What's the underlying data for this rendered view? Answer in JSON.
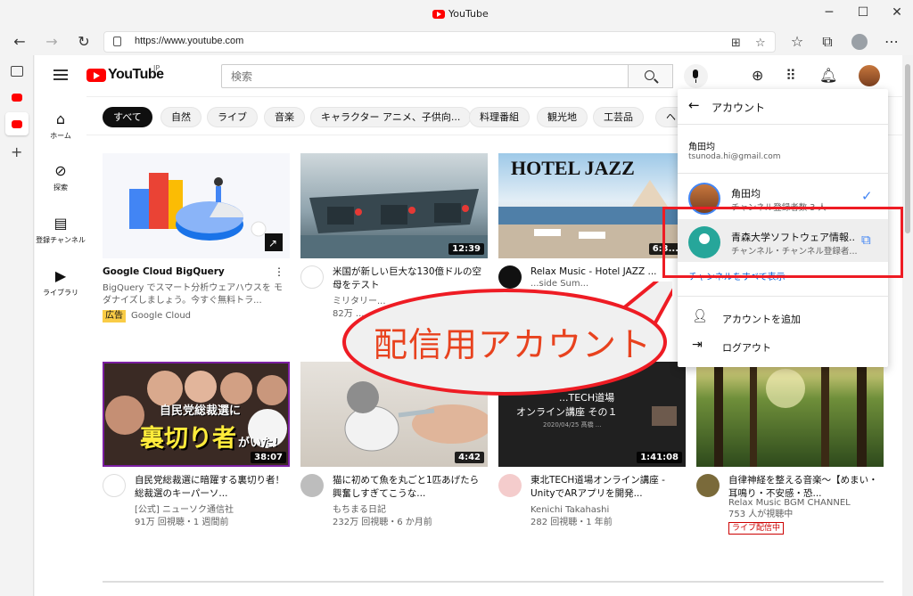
{
  "window": {
    "title": "YouTube"
  },
  "browser": {
    "url": "https://www.youtube.com"
  },
  "masthead": {
    "logo_text": "YouTube",
    "region": "JP",
    "search_placeholder": "検索"
  },
  "guide": [
    {
      "label": "ホーム",
      "icon": "home-icon"
    },
    {
      "label": "探索",
      "icon": "compass-icon"
    },
    {
      "label": "登録チャンネル",
      "icon": "subscriptions-icon"
    },
    {
      "label": "ライブラリ",
      "icon": "library-icon"
    }
  ],
  "chips": [
    "すべて",
    "自然",
    "ライブ",
    "音楽",
    "キャラクター アニメ、子供向...",
    "料理番組",
    "観光地",
    "工芸品"
  ],
  "videos": [
    {
      "title": "Google Cloud BigQuery",
      "desc": "BigQuery でスマート分析ウェアハウスを モダナイズしましょう。今すぐ無料トラ...",
      "ad": "広告",
      "channel": "Google Cloud"
    },
    {
      "title": "米国が新しい巨大な130億ドルの空母をテスト",
      "channel": "ミリタリー...",
      "stats": "82万 ...",
      "duration": "12:39"
    },
    {
      "title": "Relax Music - Hotel JAZZ ...",
      "line2": "...side Sum...",
      "thumb_text": "HOTEL JAZZ",
      "duration": "6:3..."
    },
    {
      "title": "自民党総裁選に暗躍する裏切り者！総裁選のキーパーソ...",
      "channel": "[公式] ニューソク通信社",
      "stats": "91万 回視聴・1 週間前",
      "duration": "38:07",
      "thumb_top": "自民党総裁選に",
      "thumb_main": "裏切り者",
      "thumb_tail": "がいた!"
    },
    {
      "title": "猫に初めて魚を丸ごと1匹あげたら興奮しすぎてこうな...",
      "channel": "もちまる日記",
      "stats": "232万 回視聴・6 か月前",
      "duration": "4:42"
    },
    {
      "title": "東北TECH道場オンライン講座 - UnityでARアプリを開発...",
      "channel": "Kenichi Takahashi",
      "stats": "282 回視聴・1 年前",
      "duration": "1:41:08",
      "thumb_line1": "...TECH道場",
      "thumb_line2": "オンライン講座 その１",
      "thumb_line3": "2020/04/25 髙橋 ..."
    },
    {
      "title": "自律神経を整える音楽～【めまい・耳鳴り・不安感・恐...",
      "channel": "Relax Music BGM CHANNEL",
      "stats": "753 人が視聴中",
      "live": "ライブ配信中"
    }
  ],
  "account_menu": {
    "header": "アカウント",
    "current_name": "角田均",
    "current_email": "tsunoda.hi@gmail.com",
    "accounts": [
      {
        "name": "角田均",
        "sub": "チャンネル登録者数 3 人"
      },
      {
        "name": "青森大学ソフトウェア情報...",
        "sub": "チャンネル・チャンネル登録者..."
      }
    ],
    "show_all": "チャンネルをすべて表示",
    "add_account": "アカウントを追加",
    "logout": "ログアウト"
  },
  "annotation": {
    "text": "配信用アカウント"
  },
  "colors": {
    "accent": "#ff0000",
    "annotation": "#ee1c24"
  }
}
